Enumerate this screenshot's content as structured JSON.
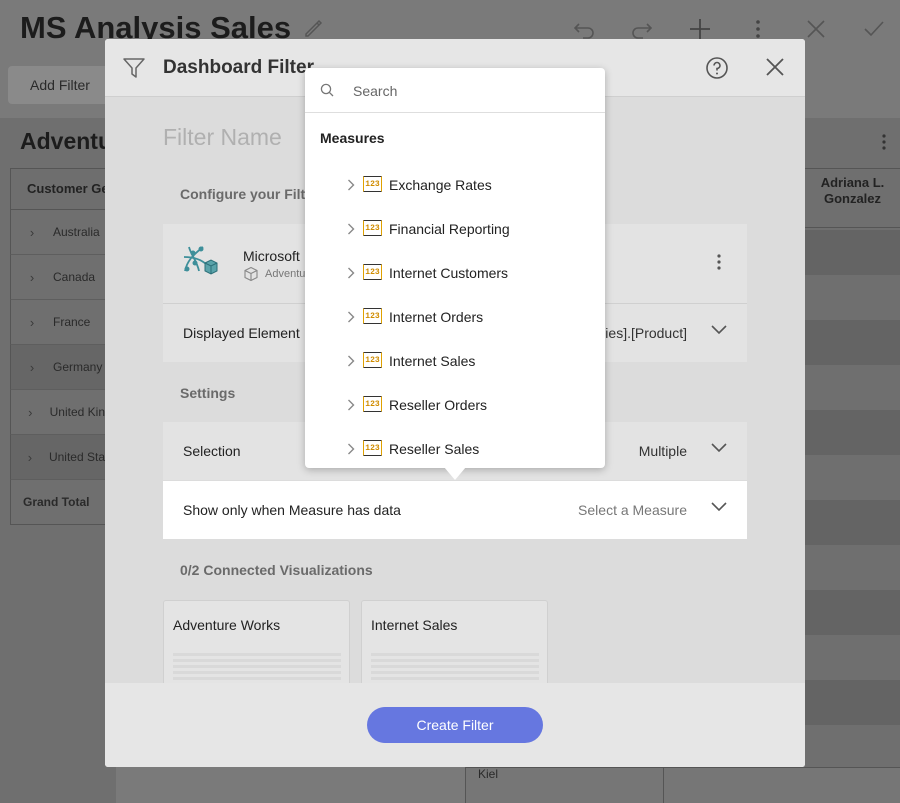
{
  "background": {
    "app_title": "MS Analysis Sales",
    "add_filter_label": "Add Filter",
    "card_title": "Adventu",
    "table_header": "Customer Ge",
    "rows": [
      "Australia",
      "Canada",
      "France",
      "Germany",
      "United Kin",
      "United Sta"
    ],
    "grand_total": "Grand Total",
    "right_header": "Adriana L. Gonzalez",
    "bottom_cell": "Kiel"
  },
  "dialog": {
    "title": "Dashboard Filter",
    "filter_name_placeholder": "Filter Name",
    "configure_label": "Configure your Filter",
    "datasource_name": "Microsoft",
    "datasource_sub": "Adventu",
    "displayed_element_label": "Displayed Element",
    "displayed_element_value": "ies].[Product]",
    "settings_label": "Settings",
    "selection_label": "Selection",
    "selection_value": "Multiple",
    "measure_label": "Show only when Measure has data",
    "measure_value": "Select a Measure",
    "connected_label": "0/2 Connected Visualizations",
    "visualizations": [
      "Adventure Works",
      "Internet Sales"
    ],
    "create_button": "Create Filter"
  },
  "popup": {
    "search_placeholder": "Search",
    "section_title": "Measures",
    "icon_text": "123",
    "items": [
      "Exchange Rates",
      "Financial Reporting",
      "Internet Customers",
      "Internet Orders",
      "Internet Sales",
      "Reseller Orders",
      "Reseller Sales"
    ]
  },
  "colors": {
    "accent": "#6677e0",
    "measure_icon": "#e0a100"
  }
}
